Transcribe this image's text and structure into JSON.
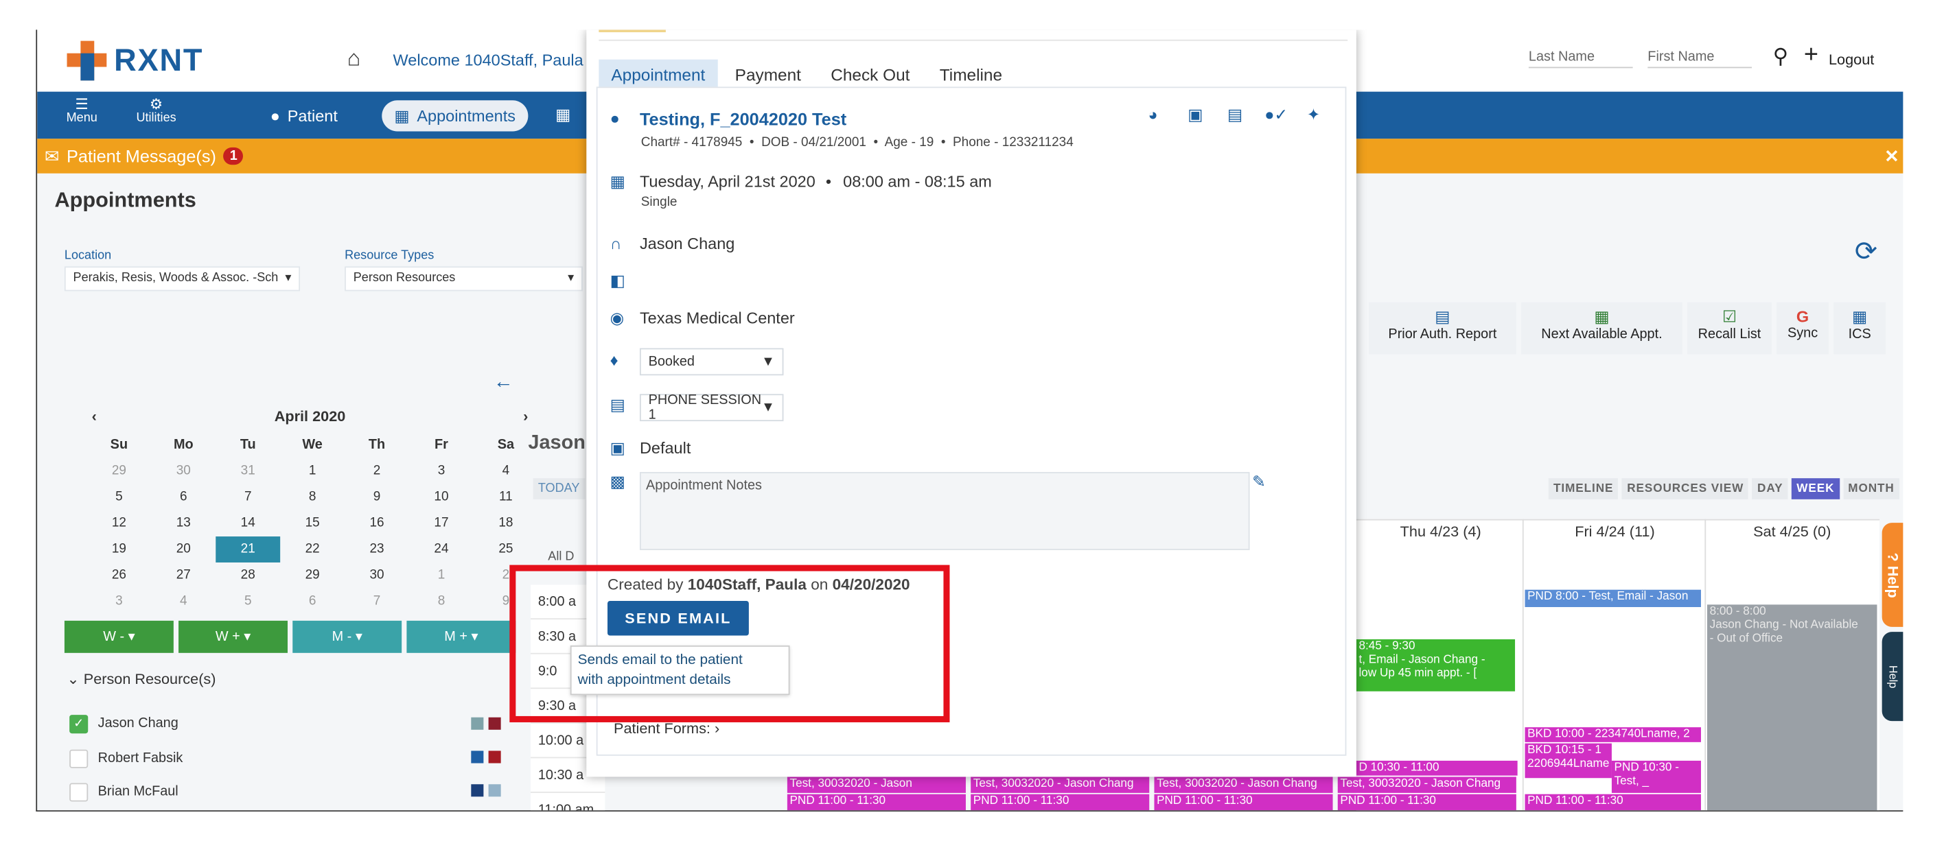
{
  "topbar": {
    "logo": "RXNT",
    "welcome": "Welcome 1040Staff, Paula",
    "last_name_placeholder": "Last Name",
    "first_name_placeholder": "First Name",
    "logout": "Logout"
  },
  "nav": {
    "menu": "Menu",
    "utilities": "Utilities",
    "patient": "Patient",
    "appointments": "Appointments"
  },
  "message_bar": {
    "label": "Patient Message(s)",
    "count": "1"
  },
  "page": {
    "title": "Appointments",
    "location_label": "Location",
    "location_value": "Perakis, Resis, Woods & Assoc. -Sch",
    "resource_types_label": "Resource Types",
    "resource_types_value": "Person Resources"
  },
  "calendar": {
    "month": "April 2020",
    "dow": [
      "Su",
      "Mo",
      "Tu",
      "We",
      "Th",
      "Fr",
      "Sa"
    ],
    "days": [
      [
        "29",
        "30",
        "31",
        "1",
        "2",
        "3",
        "4"
      ],
      [
        "5",
        "6",
        "7",
        "8",
        "9",
        "10",
        "11"
      ],
      [
        "12",
        "13",
        "14",
        "15",
        "16",
        "17",
        "18"
      ],
      [
        "19",
        "20",
        "21",
        "22",
        "23",
        "24",
        "25"
      ],
      [
        "26",
        "27",
        "28",
        "29",
        "30",
        "1",
        "2"
      ],
      [
        "3",
        "4",
        "5",
        "6",
        "7",
        "8",
        "9"
      ]
    ],
    "week_buttons": [
      "W - ▾",
      "W + ▾",
      "M - ▾",
      "M + ▾"
    ]
  },
  "resources": {
    "heading": "Person Resource(s)",
    "items": [
      {
        "name": "Jason Chang",
        "checked": true
      },
      {
        "name": "Robert Fabsik",
        "checked": false
      },
      {
        "name": "Brian McFaul",
        "checked": false
      }
    ]
  },
  "toolbar": {
    "prior_auth": "Prior Auth. Report",
    "next_available": "Next Available Appt.",
    "recall_list": "Recall List",
    "sync": "Sync",
    "ics": "ICS"
  },
  "schedule": {
    "resource_title": "Jason",
    "today": "TODAY",
    "all_day": "All D",
    "view_tabs": [
      "TIMELINE",
      "RESOURCES VIEW",
      "DAY",
      "WEEK",
      "MONTH"
    ],
    "active_view": "WEEK",
    "columns": [
      "Thu 4/23 (4)",
      "Fri 4/24 (11)",
      "Sat 4/25 (0)"
    ],
    "times": [
      "8:00 a",
      "8:30 a",
      "9:0",
      "9:30 a",
      "10:00 a",
      "10:30 a",
      "11:00 am"
    ],
    "events": {
      "fri_8": "PND 8:00 - Test, Email - Jason",
      "thu_845": "8:45 - 9:30",
      "thu_845_b": "t, Email - Jason Chang -",
      "thu_845_c": "low Up 45 min appt. - [",
      "sat_block_a": "8:00 - 8:00",
      "sat_block_b": "Jason Chang - Not Available",
      "sat_block_c": "- Out of Office",
      "fri_10": "BKD 10:00 - 2234740Lname, 2",
      "fri_1015": "BKD 10:15 - 1",
      "fri_1015_b": "2206944Lname",
      "fri_1030": "PND 10:30 -",
      "fri_1030_b": "Test, _",
      "thu_1030": "D 10:30 - 11:00",
      "row_test": "Test, 30032020 - Jason Chang",
      "row_test_short": "Test, 30032020 - Jason",
      "row_11": "PND 11:00 - 11:30"
    }
  },
  "modal": {
    "tabs": [
      "Appointment",
      "Payment",
      "Check Out",
      "Timeline"
    ],
    "patient_name": "Testing, F_20042020 Test",
    "patient_details": "Chart# - 4178945  •  DOB - 04/21/2001  •  Age - 19  •  Phone - 1233211234",
    "date": "Tuesday, April 21st 2020",
    "time": "08:00 am - 08:15 am",
    "recurrence": "Single",
    "provider": "Jason Chang",
    "facility": "Texas Medical Center",
    "status": "Booked",
    "visit_type": "PHONE SESSION 1",
    "category": "Default",
    "notes_placeholder": "Appointment Notes",
    "created_prefix": "Created by",
    "created_by": "1040Staff, Paula",
    "created_on": "on",
    "created_date": "04/20/2020",
    "send_email": "SEND EMAIL",
    "tooltip_line1": "Sends email to the patient",
    "tooltip_line2": "with appointment details",
    "patient_forms": "Patient Forms:"
  },
  "help": {
    "tab1": "? Help",
    "tab2": "Help"
  },
  "colors": {
    "brand": "#1b5e9e",
    "accent": "#e8742a",
    "message": "#f0a01c",
    "highlight": "#e5101b"
  }
}
